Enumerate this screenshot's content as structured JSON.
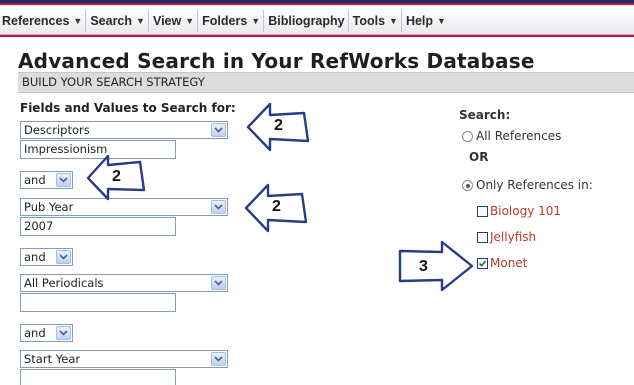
{
  "menu": {
    "items": [
      {
        "label": "References",
        "has_dropdown": true
      },
      {
        "label": "Search",
        "has_dropdown": true
      },
      {
        "label": "View",
        "has_dropdown": true
      },
      {
        "label": "Folders",
        "has_dropdown": true
      },
      {
        "label": "Bibliography",
        "has_dropdown": false
      },
      {
        "label": "Tools",
        "has_dropdown": true
      },
      {
        "label": "Help",
        "has_dropdown": true
      }
    ],
    "caret_glyph": "▼"
  },
  "page": {
    "title": "Advanced Search in Your RefWorks Database",
    "section_header": "BUILD YOUR SEARCH STRATEGY"
  },
  "left": {
    "label": "Fields and Values to Search for:",
    "field1": {
      "select": "Descriptors",
      "value": "Impressionism"
    },
    "op1": "and",
    "field2": {
      "select": "Pub Year",
      "value": "2007"
    },
    "op2": "and",
    "field3": {
      "select": "All Periodicals",
      "value": ""
    },
    "op3": "and",
    "field4": {
      "select": "Start Year",
      "value": ""
    }
  },
  "right": {
    "search_label": "Search:",
    "radio_all": {
      "label": "All References",
      "checked": false
    },
    "or_label": "OR",
    "radio_only": {
      "label": "Only References in:",
      "checked": true
    },
    "folders": [
      {
        "label": "Biology 101",
        "checked": false
      },
      {
        "label": "Jellyfish",
        "checked": false
      },
      {
        "label": "Monet",
        "checked": true
      }
    ]
  },
  "callouts": {
    "a": "2",
    "b": "2",
    "c": "2",
    "d": "3"
  },
  "colors": {
    "menu_red": "#c8102e",
    "menu_navy": "#1b2a6b",
    "folder_red": "#c0392b",
    "select_border": "#7f9db9"
  }
}
